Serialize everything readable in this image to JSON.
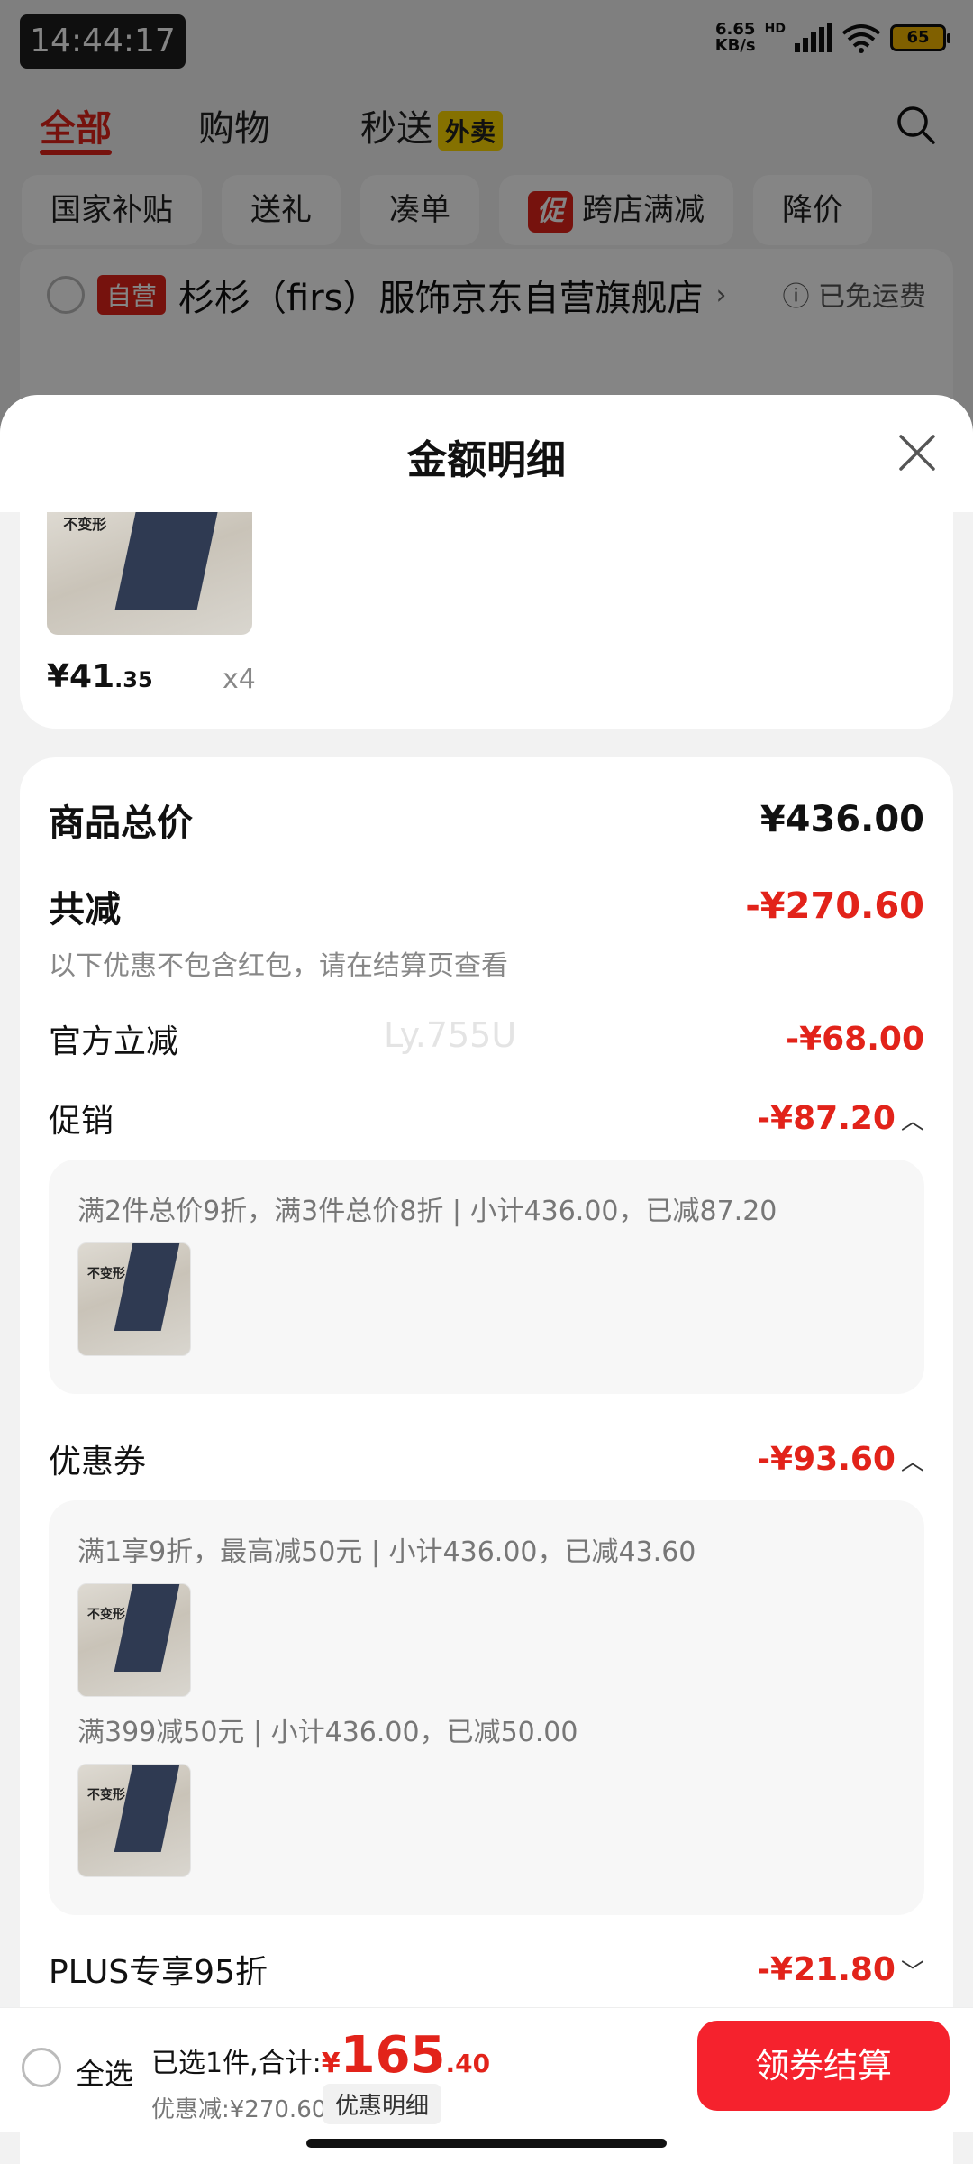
{
  "status_bar": {
    "time": "14:44:17",
    "net_speed_value": "6.65",
    "net_speed_unit": "KB/s",
    "network": "HD",
    "battery": "65"
  },
  "top_nav": {
    "tabs": [
      "全部",
      "购物",
      "秒送"
    ],
    "waimai_badge": "外卖"
  },
  "filter_chips": {
    "chip1": "国家补贴",
    "chip2": "送礼",
    "chip3": "凑单",
    "promo_tag": "促",
    "chip4": "跨店满减",
    "chip5": "降价"
  },
  "store": {
    "badge": "自营",
    "name": "杉杉（firs）服饰京东自营旗舰店",
    "shipping": "已免运费"
  },
  "sheet": {
    "title": "金额明细"
  },
  "product": {
    "price_int": "¥41",
    "price_dec": ".35",
    "qty": "x4",
    "thumb_text": "不变形"
  },
  "details": {
    "total_label": "商品总价",
    "total_value": "¥436.00",
    "reduce_label": "共减",
    "reduce_value": "-¥270.60",
    "reduce_note": "以下优惠不包含红包，请在结算页查看",
    "official_label": "官方立减",
    "official_value": "-¥68.00",
    "watermark": "Ly.755U",
    "promo_label": "促销",
    "promo_value": "-¥87.20",
    "promo_rule": "满2件总价9折，满3件总价8折 | 小计436.00，已减87.20",
    "coupon_label": "优惠券",
    "coupon_value": "-¥93.60",
    "coupon_rule1": "满1享9折，最高减50元 | 小计436.00，已减43.60",
    "coupon_rule2": "满399减50元 | 小计436.00，已减50.00",
    "plus_label": "PLUS专享95折",
    "plus_value": "-¥21.80"
  },
  "bottom_bar": {
    "select_all": "全选",
    "selected_text": "已选1件,合计:",
    "currency": "¥",
    "total_int": "165",
    "total_dec": ".40",
    "discount_text": "优惠减:¥270.60",
    "detail_button": "优惠明细",
    "checkout_button": "领券结算"
  },
  "colors": {
    "accent": "#e2231a",
    "checkout": "#f5222d"
  }
}
